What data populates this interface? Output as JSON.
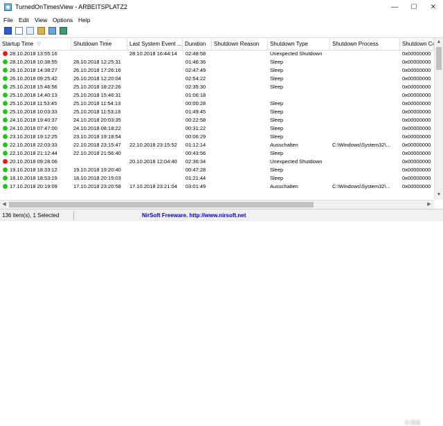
{
  "window": {
    "title": "TurnedOnTimesView  -  ARBEITSPLATZ2",
    "controls": [
      "—",
      "☐",
      "✕"
    ]
  },
  "menu": [
    "File",
    "Edit",
    "View",
    "Options",
    "Help"
  ],
  "toolbar": [
    "save-icon",
    "html-report-icon",
    "copy-icon",
    "properties-icon",
    "refresh-icon",
    "exit-icon"
  ],
  "columns": [
    "Startup Time",
    "Shutdown Time",
    "Last System Event ...",
    "Duration",
    "Shutdown Reason",
    "Shutdown Type",
    "Shutdown Process",
    "Shutdown Co"
  ],
  "sort_indicator": "▽",
  "status_colors": {
    "ok": "#22c31b",
    "error": "#e01c1c"
  },
  "rows": [
    {
      "status": "error",
      "startup": "28.10.2018 13:55:16",
      "shutdown": "",
      "last_event": "28.10.2018 16:44:14",
      "duration": "02:48:58",
      "reason": "",
      "type": "Unexpected Shutdown",
      "process": "",
      "code": "0x00000000"
    },
    {
      "status": "ok",
      "startup": "28.10.2018 10:38:55",
      "shutdown": "28.10.2018 12:25:31",
      "last_event": "",
      "duration": "01:46:36",
      "reason": "",
      "type": "Sleep",
      "process": "",
      "code": "0x00000000"
    },
    {
      "status": "ok",
      "startup": "26.10.2018 14:38:27",
      "shutdown": "26.10.2018 17:26:16",
      "last_event": "",
      "duration": "02:47:49",
      "reason": "",
      "type": "Sleep",
      "process": "",
      "code": "0x00000000"
    },
    {
      "status": "ok",
      "startup": "26.10.2018 09:25:42",
      "shutdown": "26.10.2018 12:20:04",
      "last_event": "",
      "duration": "02:54:22",
      "reason": "",
      "type": "Sleep",
      "process": "",
      "code": "0x00000000"
    },
    {
      "status": "ok",
      "startup": "25.10.2018 15:46:56",
      "shutdown": "25.10.2018 18:22:26",
      "last_event": "",
      "duration": "02:35:30",
      "reason": "",
      "type": "Sleep",
      "process": "",
      "code": "0x00000000"
    },
    {
      "status": "ok",
      "startup": "25.10.2018 14:40:13",
      "shutdown": "25.10.2018 15:46:31",
      "last_event": "",
      "duration": "01:06:18",
      "reason": "",
      "type": "",
      "process": "",
      "code": "0x00000000"
    },
    {
      "status": "ok",
      "startup": "25.10.2018 11:53:45",
      "shutdown": "25.10.2018 11:54:13",
      "last_event": "",
      "duration": "00:00:28",
      "reason": "",
      "type": "Sleep",
      "process": "",
      "code": "0x00000000"
    },
    {
      "status": "ok",
      "startup": "25.10.2018 10:03:33",
      "shutdown": "25.10.2018 11:53:18",
      "last_event": "",
      "duration": "01:49:45",
      "reason": "",
      "type": "Sleep",
      "process": "",
      "code": "0x00000000"
    },
    {
      "status": "ok",
      "startup": "24.10.2018 19:40:37",
      "shutdown": "24.10.2018 20:03:35",
      "last_event": "",
      "duration": "00:22:58",
      "reason": "",
      "type": "Sleep",
      "process": "",
      "code": "0x00000000"
    },
    {
      "status": "ok",
      "startup": "24.10.2018 07:47:00",
      "shutdown": "24.10.2018 08:18:22",
      "last_event": "",
      "duration": "00:31:22",
      "reason": "",
      "type": "Sleep",
      "process": "",
      "code": "0x00000000"
    },
    {
      "status": "ok",
      "startup": "23.10.2018 19:12:25",
      "shutdown": "23.10.2018 19:18:54",
      "last_event": "",
      "duration": "00:06:29",
      "reason": "",
      "type": "Sleep",
      "process": "",
      "code": "0x00000000"
    },
    {
      "status": "ok",
      "startup": "22.10.2018 22:03:33",
      "shutdown": "22.10.2018 23:15:47",
      "last_event": "22.10.2018 23:15:52",
      "duration": "01:12:14",
      "reason": "",
      "type": "Ausschalten",
      "process": "C:\\Windows\\System32\\...",
      "code": "0x00000000"
    },
    {
      "status": "ok",
      "startup": "22.10.2018 21:12:44",
      "shutdown": "22.10.2018 21:56:40",
      "last_event": "",
      "duration": "00:43:56",
      "reason": "",
      "type": "Sleep",
      "process": "",
      "code": "0x00000000"
    },
    {
      "status": "error",
      "startup": "20.10.2018 09:28:06",
      "shutdown": "",
      "last_event": "20.10.2018 12:04:40",
      "duration": "02:36:34",
      "reason": "",
      "type": "Unexpected Shutdown",
      "process": "",
      "code": "0x00000000"
    },
    {
      "status": "ok",
      "startup": "19.10.2018 18:33:12",
      "shutdown": "19.10.2018 19:20:40",
      "last_event": "",
      "duration": "00:47:28",
      "reason": "",
      "type": "Sleep",
      "process": "",
      "code": "0x00000000"
    },
    {
      "status": "ok",
      "startup": "18.10.2018 18:53:19",
      "shutdown": "18.10.2018 20:15:03",
      "last_event": "",
      "duration": "01:21:44",
      "reason": "",
      "type": "Sleep",
      "process": "",
      "code": "0x00000000"
    },
    {
      "status": "ok",
      "startup": "17.10.2018 20:19:09",
      "shutdown": "17.10.2018 23:20:58",
      "last_event": "17.10.2018 23:21:04",
      "duration": "03:01:49",
      "reason": "",
      "type": "Ausschalten",
      "process": "C:\\Windows\\System32\\...",
      "code": "0x00000000"
    }
  ],
  "status": {
    "left": "136 item(s), 1 Selected",
    "center": "NirSoft Freeware.  http://www.nirsoft.net"
  },
  "watermark": "© IDG"
}
